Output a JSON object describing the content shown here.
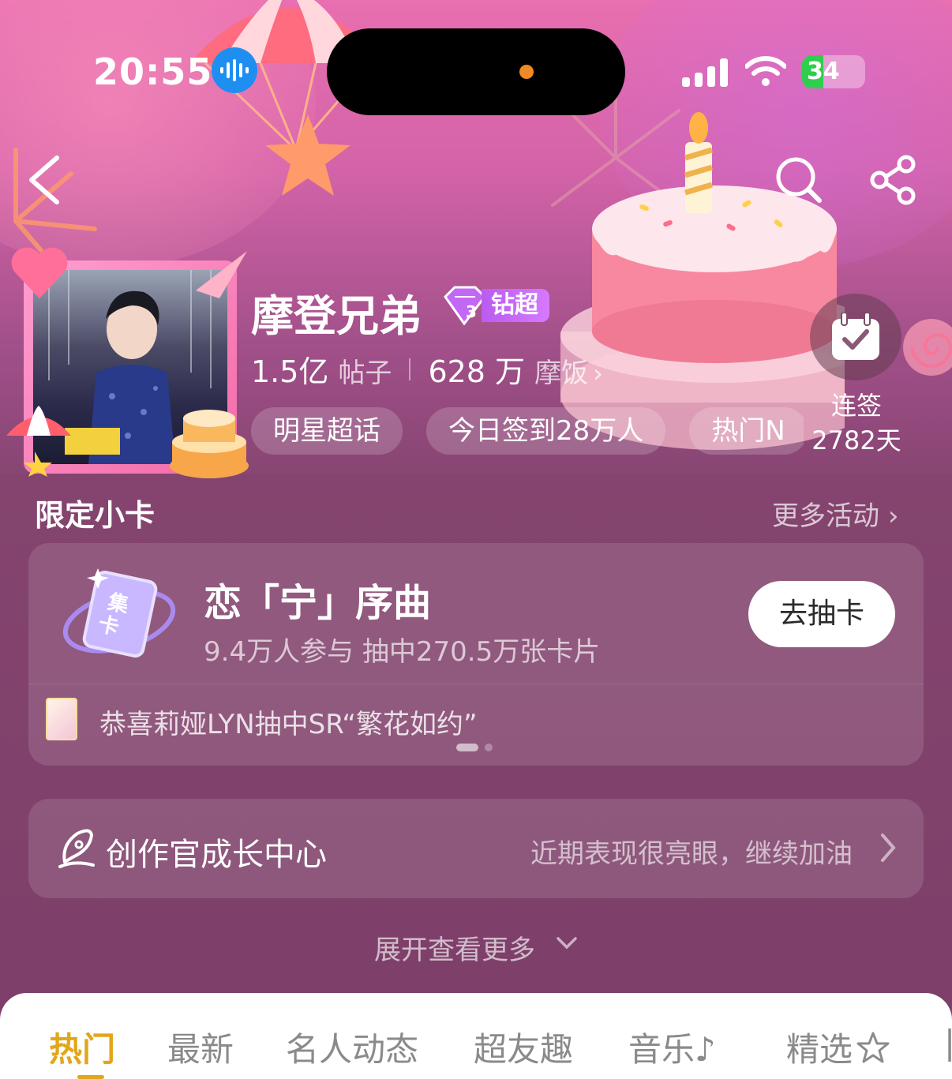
{
  "status_bar": {
    "time": "20:55",
    "battery": "34",
    "battery_level": 0.34,
    "accent_voice": "#1f8ef1"
  },
  "header": {
    "back_icon": "chevron-left-icon",
    "search_icon": "search-icon",
    "share_icon": "share-icon"
  },
  "profile": {
    "name": "摩登兄弟",
    "badge": "钻超",
    "posts_count": "1.5亿",
    "posts_label": "帖子",
    "fans_count": "628 万",
    "fans_label": "摩饭",
    "chips": [
      "明星超话",
      "今日签到28万人",
      "热门N"
    ],
    "signin_label": "连签",
    "signin_days": "2782天"
  },
  "section": {
    "title": "限定小卡",
    "more": "更多活动"
  },
  "card": {
    "title": "恋「宁」序曲",
    "subtitle": "9.4万人参与 抽中270.5万张卡片",
    "button": "去抽卡",
    "congrats": "恭喜莉娅LYN抽中SR“繁花如约”"
  },
  "growth": {
    "title": "创作官成长中心",
    "desc": "近期表现很亮眼，继续加油"
  },
  "expand": "展开查看更多",
  "tabs": [
    {
      "label": "热门",
      "active": true
    },
    {
      "label": "最新"
    },
    {
      "label": "名人动态"
    },
    {
      "label": "超友趣"
    },
    {
      "label": "音乐"
    },
    {
      "label": "精选"
    }
  ],
  "colors": {
    "accent_tab": "#e2a61a",
    "battery_green": "#2fce4e",
    "badge_purple": "#c268f5"
  }
}
